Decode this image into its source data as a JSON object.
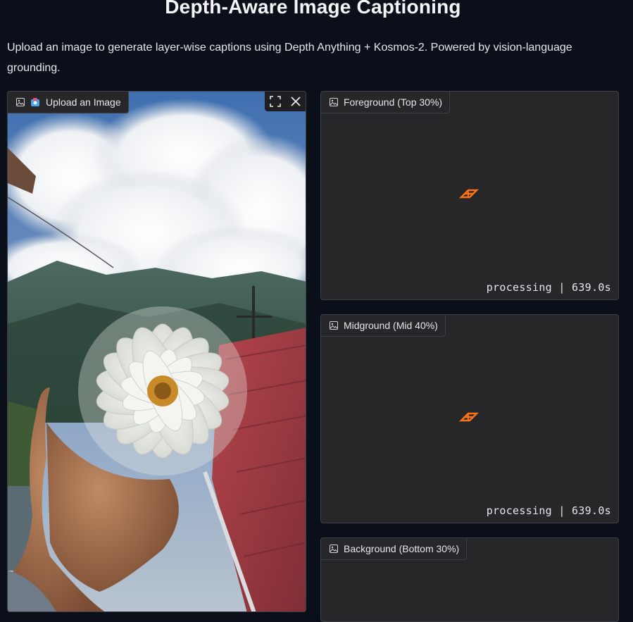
{
  "header": {
    "title": "Depth-Aware Image Captioning",
    "description": "Upload an image to generate layer-wise captions using Depth Anything + Kosmos-2. Powered by vision-language grounding."
  },
  "upload": {
    "label": "Upload an Image",
    "icon": "image-icon",
    "fullscreen_icon": "fullscreen-icon",
    "close_icon": "close-icon"
  },
  "outputs": [
    {
      "label": "Foreground (Top 30%)",
      "status": "processing | 639.0s"
    },
    {
      "label": "Midground (Mid 40%)",
      "status": "processing | 639.0s"
    },
    {
      "label": "Background (Bottom 30%)",
      "status": ""
    }
  ],
  "colors": {
    "background": "#0b0f19",
    "panel": "#27272a",
    "border": "#3f3f46",
    "accent": "#f97316"
  }
}
